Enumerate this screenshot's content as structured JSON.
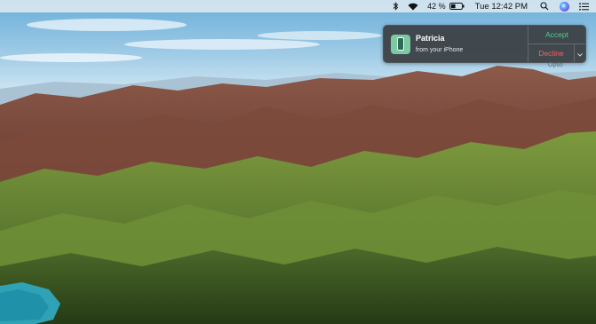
{
  "menubar": {
    "icons": [
      "bluetooth-icon",
      "wifi-icon",
      "battery-icon",
      "spotlight-search-icon",
      "siri-icon",
      "notification-center-icon"
    ],
    "battery_percent": "42 %",
    "battery_level_fraction": 0.42,
    "clock": "Tue 12:42 PM"
  },
  "notification": {
    "app_icon": "iphone-continuity-icon",
    "title": "Patricia",
    "subtitle": "from your iPhone",
    "accept_label": "Accept",
    "decline_label": "Decline",
    "options_icon": "chevron-down-icon",
    "peek_text": "Optio",
    "colors": {
      "accept": "#49d18d",
      "decline": "#ff5a5f",
      "background": "#3a3e42"
    }
  },
  "desktop": {
    "wallpaper": "mountain-landscape-wallpaper"
  }
}
